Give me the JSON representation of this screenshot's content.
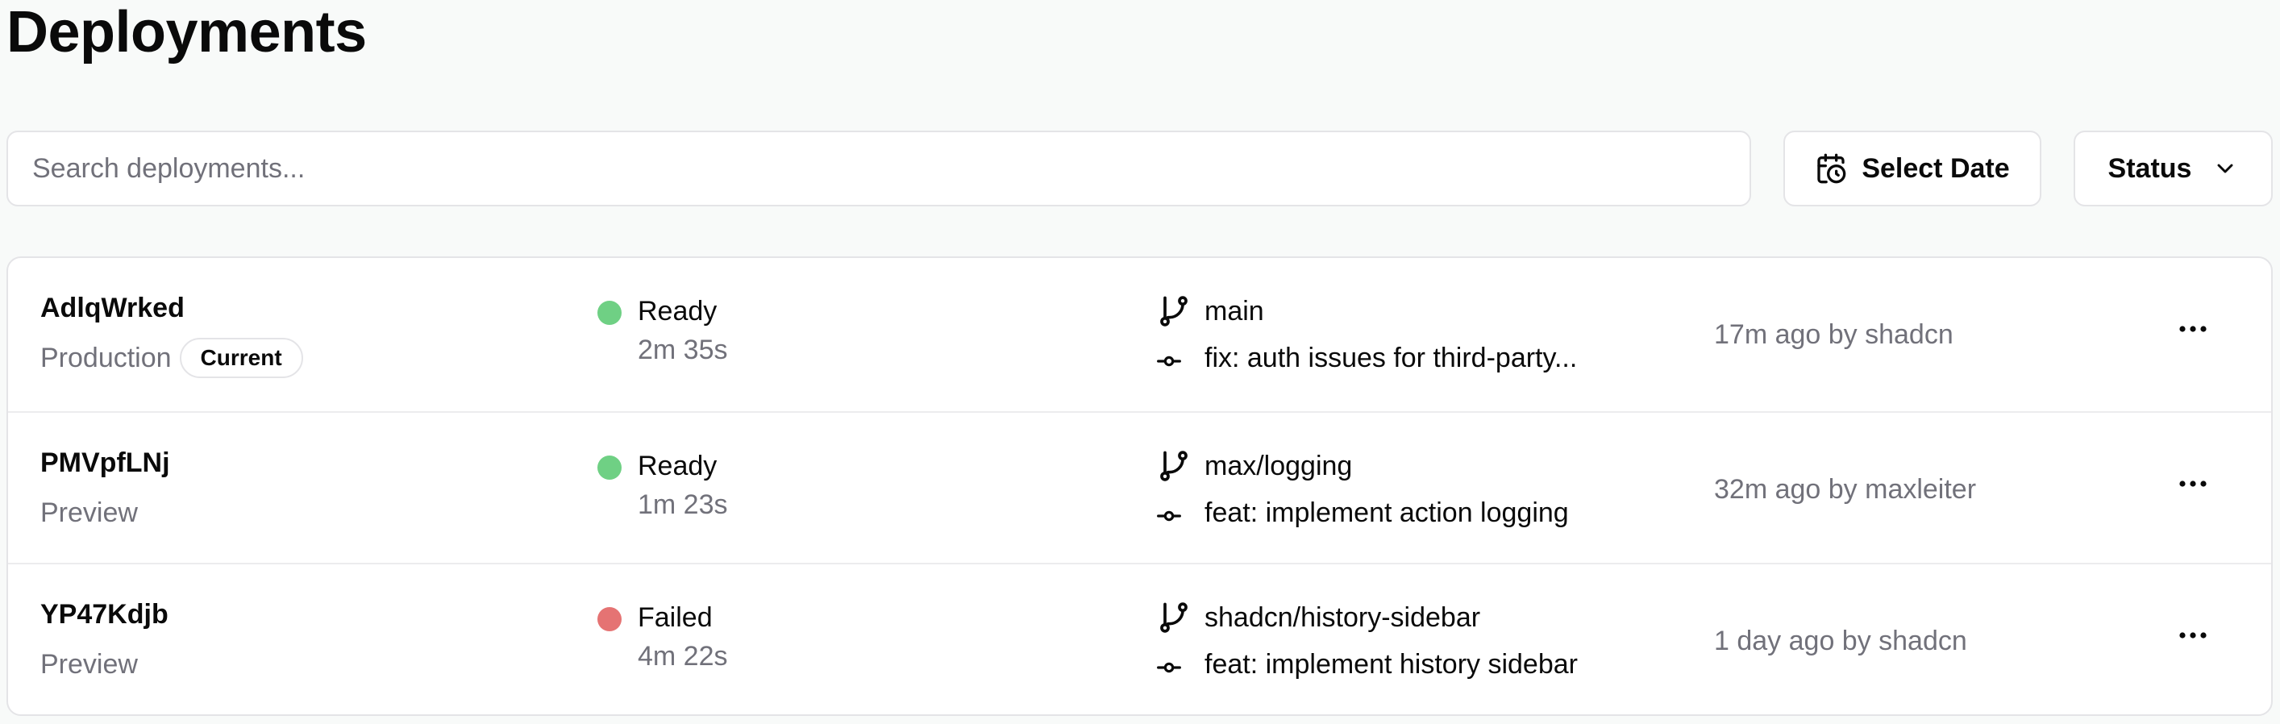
{
  "page": {
    "title": "Deployments"
  },
  "toolbar": {
    "search_placeholder": "Search deployments...",
    "date_label": "Select Date",
    "status_label": "Status"
  },
  "colors": {
    "ready": "#6fd084",
    "failed": "#e57373"
  },
  "deployments": [
    {
      "id": "AdlqWrked",
      "environment": "Production",
      "badge": "Current",
      "status": "Ready",
      "duration": "2m 35s",
      "branch": "main",
      "commit": "fix: auth issues for third-party...",
      "meta": "17m ago by shadcn"
    },
    {
      "id": "PMVpfLNj",
      "environment": "Preview",
      "badge": "",
      "status": "Ready",
      "duration": "1m 23s",
      "branch": "max/logging",
      "commit": "feat: implement action logging",
      "meta": "32m ago by maxleiter"
    },
    {
      "id": "YP47Kdjb",
      "environment": "Preview",
      "badge": "",
      "status": "Failed",
      "duration": "4m 22s",
      "branch": "shadcn/history-sidebar",
      "commit": "feat: implement history sidebar",
      "meta": "1 day ago by shadcn"
    }
  ],
  "icons": {
    "date": "calendar-clock-icon",
    "status": "chevron-down-icon",
    "branch": "git-branch-icon",
    "commit": "git-commit-icon",
    "more": "more-horizontal-icon"
  }
}
